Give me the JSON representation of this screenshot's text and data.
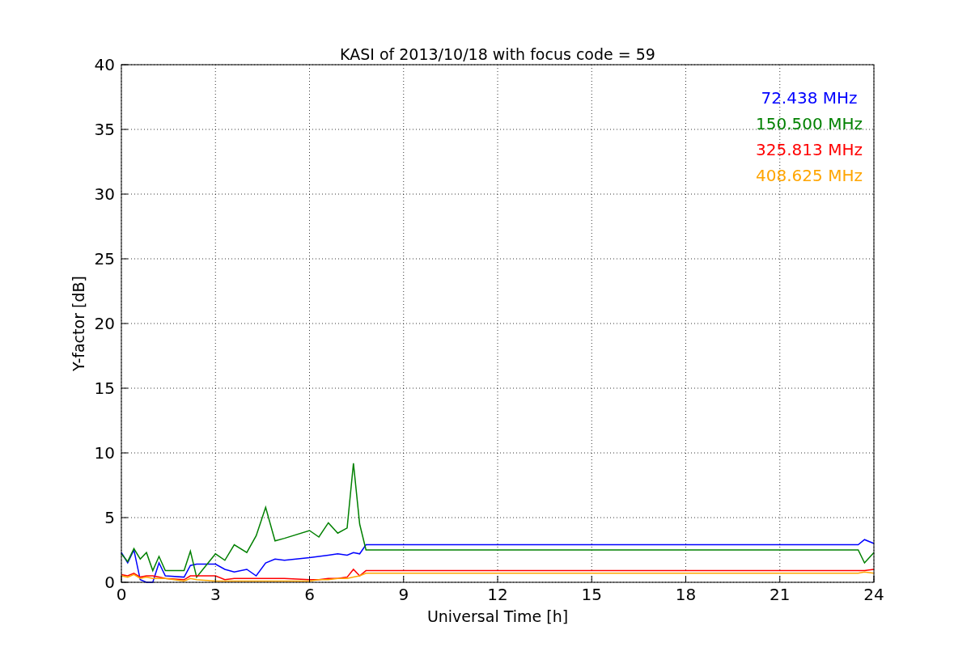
{
  "chart_data": {
    "type": "line",
    "title": "KASI of 2013/10/18 with focus code = 59",
    "xlabel": "Universal Time [h]",
    "ylabel": "Y-factor [dB]",
    "x": [
      0,
      0.2,
      0.4,
      0.6,
      0.8,
      1.0,
      1.2,
      1.4,
      2.0,
      2.2,
      2.4,
      3.0,
      3.3,
      3.6,
      4.0,
      4.3,
      4.6,
      4.9,
      5.2,
      6.0,
      6.3,
      6.6,
      6.9,
      7.2,
      7.4,
      7.6,
      7.8,
      23.5,
      23.7,
      24
    ],
    "series": [
      {
        "name": "72.438 MHz",
        "color": "#0000ff",
        "values": [
          2.3,
          1.5,
          2.5,
          0.2,
          0.0,
          0.0,
          1.5,
          0.5,
          0.4,
          1.3,
          1.4,
          1.4,
          1.0,
          0.8,
          1.0,
          0.5,
          1.5,
          1.8,
          1.7,
          1.9,
          2.0,
          2.1,
          2.2,
          2.1,
          2.3,
          2.2,
          2.9,
          2.9,
          3.3,
          3.0
        ]
      },
      {
        "name": "150.500 MHz",
        "color": "#008000",
        "values": [
          2.2,
          1.6,
          2.6,
          1.8,
          2.3,
          0.9,
          2.0,
          0.9,
          0.9,
          2.4,
          0.4,
          2.2,
          1.7,
          2.9,
          2.3,
          3.6,
          5.8,
          3.2,
          3.4,
          4.0,
          3.5,
          4.6,
          3.8,
          4.2,
          9.2,
          4.5,
          2.5,
          2.5,
          1.5,
          2.3
        ]
      },
      {
        "name": "325.813 MHz",
        "color": "#ff0000",
        "values": [
          0.6,
          0.5,
          0.7,
          0.4,
          0.5,
          0.5,
          0.4,
          0.3,
          0.2,
          0.5,
          0.5,
          0.5,
          0.2,
          0.3,
          0.3,
          0.3,
          0.3,
          0.3,
          0.3,
          0.2,
          0.2,
          0.3,
          0.3,
          0.4,
          1.0,
          0.5,
          0.9,
          0.9,
          0.9,
          1.0
        ]
      },
      {
        "name": "408.625 MHz",
        "color": "#ffa500",
        "values": [
          0.5,
          0.4,
          0.6,
          0.3,
          0.4,
          0.3,
          0.3,
          0.3,
          0.1,
          0.3,
          0.2,
          0.1,
          0.1,
          0.1,
          0.1,
          0.1,
          0.1,
          0.1,
          0.1,
          0.1,
          0.2,
          0.2,
          0.3,
          0.3,
          0.4,
          0.5,
          0.7,
          0.7,
          0.8,
          0.7
        ]
      }
    ],
    "grid": true,
    "xlim": [
      0,
      24
    ],
    "ylim": [
      0,
      40
    ],
    "xticks": [
      0,
      3,
      6,
      9,
      12,
      15,
      18,
      21,
      24
    ],
    "yticks": [
      0,
      5,
      10,
      15,
      20,
      25,
      30,
      35,
      40
    ]
  }
}
